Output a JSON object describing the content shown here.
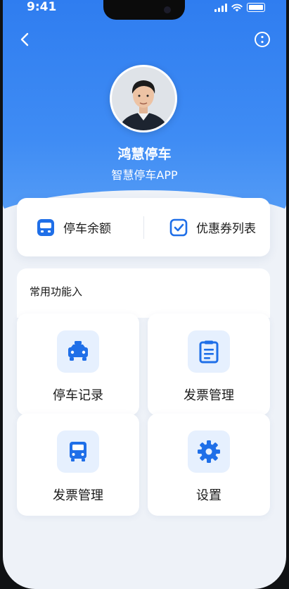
{
  "status": {
    "time": "9:41"
  },
  "profile": {
    "name": "鸿慧停车",
    "subtitle": "智慧停车APP"
  },
  "balance_bar": {
    "left_label": "停车余额",
    "right_label": "优惠券列表"
  },
  "functions": {
    "title": "常用功能入",
    "tiles": [
      {
        "label": "停车记录",
        "icon": "car-icon"
      },
      {
        "label": "发票管理",
        "icon": "document-icon"
      },
      {
        "label": "发票管理",
        "icon": "bus-icon"
      },
      {
        "label": "设置",
        "icon": "gear-icon"
      }
    ]
  },
  "colors": {
    "accent": "#2f7df0",
    "icon_bg": "#e6f0fe",
    "icon": "#1f6fe8"
  }
}
